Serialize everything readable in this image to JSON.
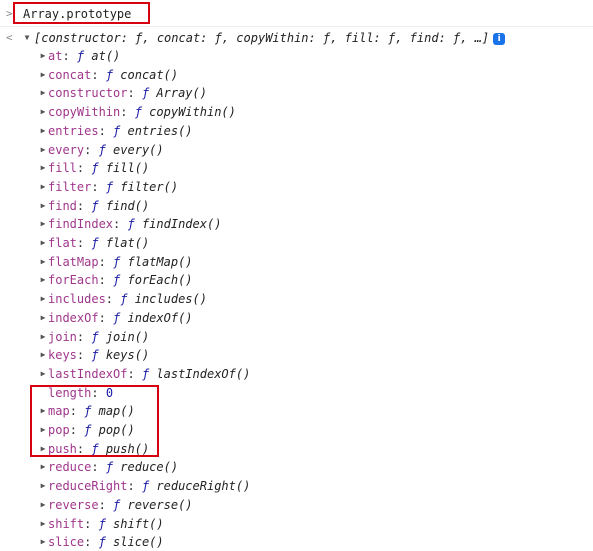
{
  "input": {
    "prompt_icon": ">",
    "text": "Array.prototype"
  },
  "output": {
    "result_icon": "<",
    "summary": "[constructor: ƒ, concat: ƒ, copyWithin: ƒ, fill: ƒ, find: ƒ, …]",
    "info_badge": "i",
    "expand_symbol": "▼"
  },
  "properties": [
    {
      "key": "at",
      "fsym": "ƒ",
      "value": "at()",
      "expandable": true
    },
    {
      "key": "concat",
      "fsym": "ƒ",
      "value": "concat()",
      "expandable": true
    },
    {
      "key": "constructor",
      "fsym": "ƒ",
      "value": "Array()",
      "expandable": true
    },
    {
      "key": "copyWithin",
      "fsym": "ƒ",
      "value": "copyWithin()",
      "expandable": true
    },
    {
      "key": "entries",
      "fsym": "ƒ",
      "value": "entries()",
      "expandable": true
    },
    {
      "key": "every",
      "fsym": "ƒ",
      "value": "every()",
      "expandable": true
    },
    {
      "key": "fill",
      "fsym": "ƒ",
      "value": "fill()",
      "expandable": true
    },
    {
      "key": "filter",
      "fsym": "ƒ",
      "value": "filter()",
      "expandable": true
    },
    {
      "key": "find",
      "fsym": "ƒ",
      "value": "find()",
      "expandable": true
    },
    {
      "key": "findIndex",
      "fsym": "ƒ",
      "value": "findIndex()",
      "expandable": true
    },
    {
      "key": "flat",
      "fsym": "ƒ",
      "value": "flat()",
      "expandable": true
    },
    {
      "key": "flatMap",
      "fsym": "ƒ",
      "value": "flatMap()",
      "expandable": true
    },
    {
      "key": "forEach",
      "fsym": "ƒ",
      "value": "forEach()",
      "expandable": true
    },
    {
      "key": "includes",
      "fsym": "ƒ",
      "value": "includes()",
      "expandable": true
    },
    {
      "key": "indexOf",
      "fsym": "ƒ",
      "value": "indexOf()",
      "expandable": true
    },
    {
      "key": "join",
      "fsym": "ƒ",
      "value": "join()",
      "expandable": true
    },
    {
      "key": "keys",
      "fsym": "ƒ",
      "value": "keys()",
      "expandable": true
    },
    {
      "key": "lastIndexOf",
      "fsym": "ƒ",
      "value": "lastIndexOf()",
      "expandable": true
    },
    {
      "key": "length",
      "fsym": "",
      "value": "0",
      "expandable": false
    },
    {
      "key": "map",
      "fsym": "ƒ",
      "value": "map()",
      "expandable": true
    },
    {
      "key": "pop",
      "fsym": "ƒ",
      "value": "pop()",
      "expandable": true
    },
    {
      "key": "push",
      "fsym": "ƒ",
      "value": "push()",
      "expandable": true
    },
    {
      "key": "reduce",
      "fsym": "ƒ",
      "value": "reduce()",
      "expandable": true
    },
    {
      "key": "reduceRight",
      "fsym": "ƒ",
      "value": "reduceRight()",
      "expandable": true
    },
    {
      "key": "reverse",
      "fsym": "ƒ",
      "value": "reverse()",
      "expandable": true
    },
    {
      "key": "shift",
      "fsym": "ƒ",
      "value": "shift()",
      "expandable": true
    },
    {
      "key": "slice",
      "fsym": "ƒ",
      "value": "slice()",
      "expandable": true
    }
  ],
  "colors": {
    "highlight_box": "#d6000f",
    "property_key": "#a0368b",
    "function_symbol": "#1a1aa6",
    "number_value": "#1a1aa6",
    "info_badge": "#1a73e8"
  }
}
